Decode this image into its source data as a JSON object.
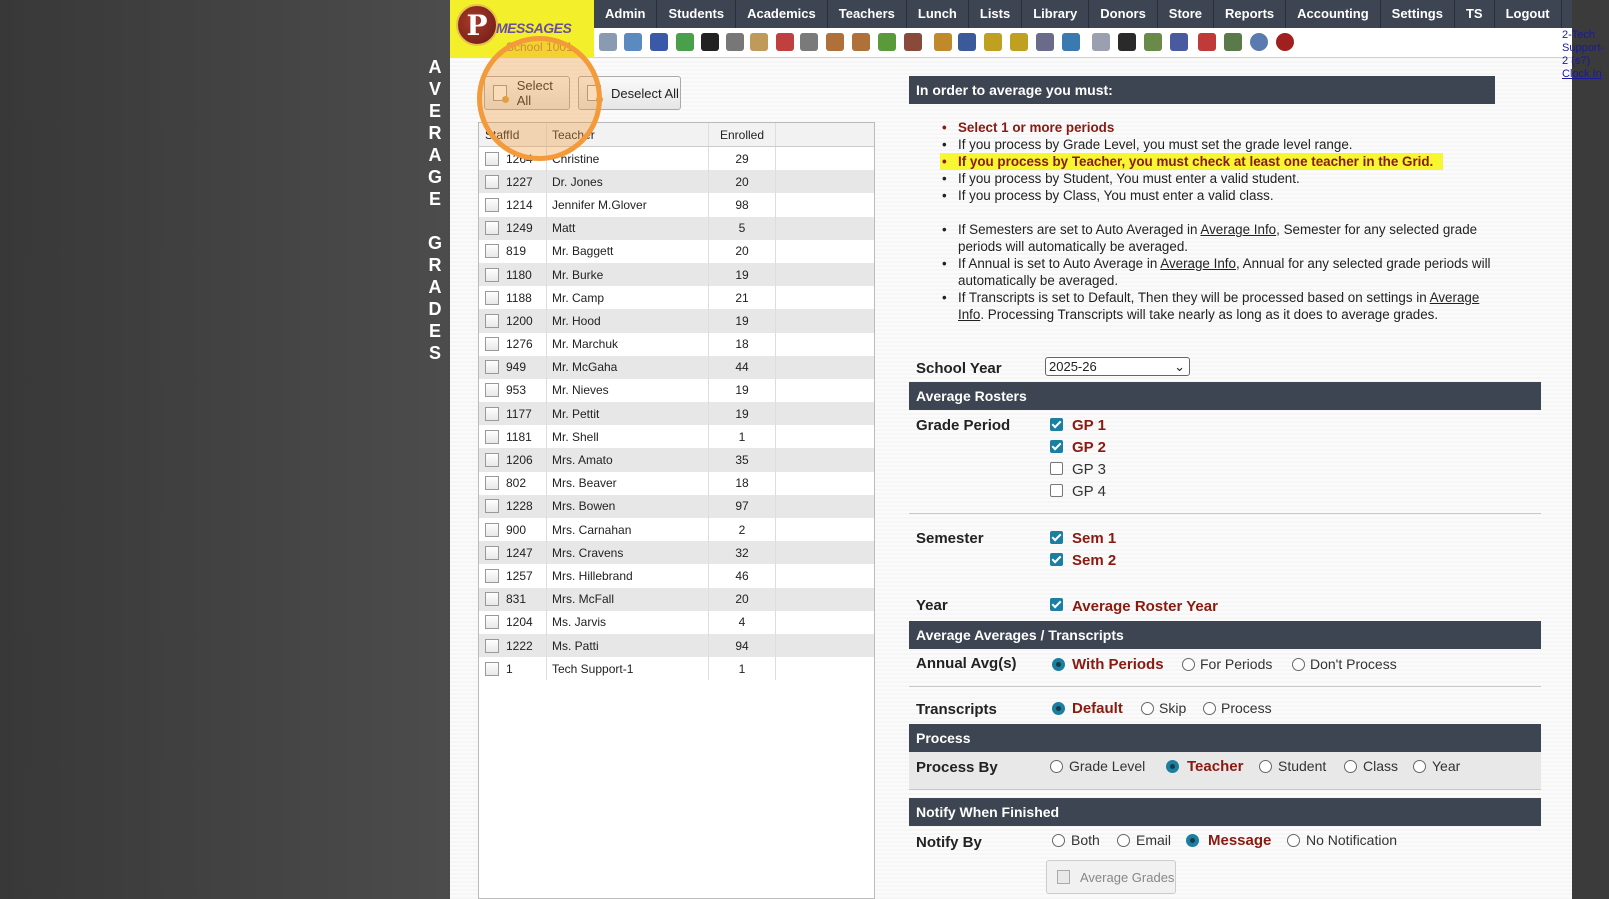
{
  "page_vertical_title": [
    "A",
    "V",
    "E",
    "R",
    "A",
    "G",
    "E",
    "",
    "G",
    "R",
    "A",
    "D",
    "E",
    "S"
  ],
  "header": {
    "logo_letter": "P",
    "logo_text": "MESSAGES",
    "logo_sub": "School 1001",
    "nav": [
      "Admin",
      "Students",
      "Academics",
      "Teachers",
      "Lunch",
      "Lists",
      "Library",
      "Donors",
      "Store",
      "Reports",
      "Accounting",
      "Settings",
      "TS",
      "Logout"
    ],
    "user": "2-Tech Support-2 (s7)",
    "clock_in": "Clock In"
  },
  "buttons": {
    "select_all": "Select All",
    "deselect_all": "Deselect All"
  },
  "grid": {
    "headers": {
      "id": "StaffId",
      "name": "Teacher",
      "enrolled": "Enrolled"
    },
    "rows": [
      {
        "id": "1264",
        "name": "Christine",
        "enrolled": "29"
      },
      {
        "id": "1227",
        "name": "Dr. Jones",
        "enrolled": "20"
      },
      {
        "id": "1214",
        "name": "Jennifer M.Glover",
        "enrolled": "98"
      },
      {
        "id": "1249",
        "name": "Matt",
        "enrolled": "5"
      },
      {
        "id": "819",
        "name": "Mr. Baggett",
        "enrolled": "20"
      },
      {
        "id": "1180",
        "name": "Mr. Burke",
        "enrolled": "19"
      },
      {
        "id": "1188",
        "name": "Mr. Camp",
        "enrolled": "21"
      },
      {
        "id": "1200",
        "name": "Mr. Hood",
        "enrolled": "19"
      },
      {
        "id": "1276",
        "name": "Mr. Marchuk",
        "enrolled": "18"
      },
      {
        "id": "949",
        "name": "Mr. McGaha",
        "enrolled": "44"
      },
      {
        "id": "953",
        "name": "Mr. Nieves",
        "enrolled": "19"
      },
      {
        "id": "1177",
        "name": "Mr. Pettit",
        "enrolled": "19"
      },
      {
        "id": "1181",
        "name": "Mr. Shell",
        "enrolled": "1"
      },
      {
        "id": "1206",
        "name": "Mrs. Amato",
        "enrolled": "35"
      },
      {
        "id": "802",
        "name": "Mrs. Beaver",
        "enrolled": "18"
      },
      {
        "id": "1228",
        "name": "Mrs. Bowen",
        "enrolled": "97"
      },
      {
        "id": "900",
        "name": "Mrs. Carnahan",
        "enrolled": "2"
      },
      {
        "id": "1247",
        "name": "Mrs. Cravens",
        "enrolled": "32"
      },
      {
        "id": "1257",
        "name": "Mrs. Hillebrand",
        "enrolled": "46"
      },
      {
        "id": "831",
        "name": "Mrs. McFall",
        "enrolled": "20"
      },
      {
        "id": "1204",
        "name": "Ms. Jarvis",
        "enrolled": "4"
      },
      {
        "id": "1222",
        "name": "Ms. Patti",
        "enrolled": "94"
      },
      {
        "id": "1",
        "name": "Tech Support-1",
        "enrolled": "1"
      }
    ]
  },
  "info": {
    "title": "In order to average you must:",
    "l1": "Select 1 or more periods",
    "l2": "If you process by Grade Level, you must set the grade level range.",
    "l3": "If you process by Teacher, you must check at least one teacher in the Grid.",
    "l4": "If you process by Student, You must enter a valid student.",
    "l5": "If you process by Class, You must enter a valid class.",
    "l6a": "If Semesters are set to Auto Averaged in ",
    "l6link": "Average Info",
    "l6b": ", Semester for any selected grade periods will automatically be averaged.",
    "l7a": "If Annual is set to Auto Average in ",
    "l7link": "Average Info",
    "l7b": ", Annual for any selected grade periods will automatically be averaged.",
    "l8a": "If Transcripts is set to Default, Then they will be processed based on settings in ",
    "l8link": "Average Info",
    "l8b": ". Processing Transcripts will take nearly as long as it does to average grades."
  },
  "form": {
    "school_year_label": "School Year",
    "school_year_value": "2025-26",
    "avg_rosters_title": "Average Rosters",
    "grade_period_label": "Grade Period",
    "gp": [
      "GP 1",
      "GP 2",
      "GP 3",
      "GP 4"
    ],
    "semester_label": "Semester",
    "sem": [
      "Sem 1",
      "Sem 2"
    ],
    "year_label": "Year",
    "year_opt": "Average Roster Year",
    "avg_avgs_title": "Average Averages / Transcripts",
    "annual_label": "Annual Avg(s)",
    "annual_opts": [
      "With Periods",
      "For Periods",
      "Don't Process"
    ],
    "transcripts_label": "Transcripts",
    "transcript_opts": [
      "Default",
      "Skip",
      "Process"
    ],
    "process_title": "Process",
    "process_by_label": "Process By",
    "process_opts": [
      "Grade Level",
      "Teacher",
      "Student",
      "Class",
      "Year"
    ],
    "notify_title": "Notify When Finished",
    "notify_label": "Notify By",
    "notify_opts": [
      "Both",
      "Email",
      "Message",
      "No Notification"
    ],
    "avg_button": "Average Grades"
  }
}
